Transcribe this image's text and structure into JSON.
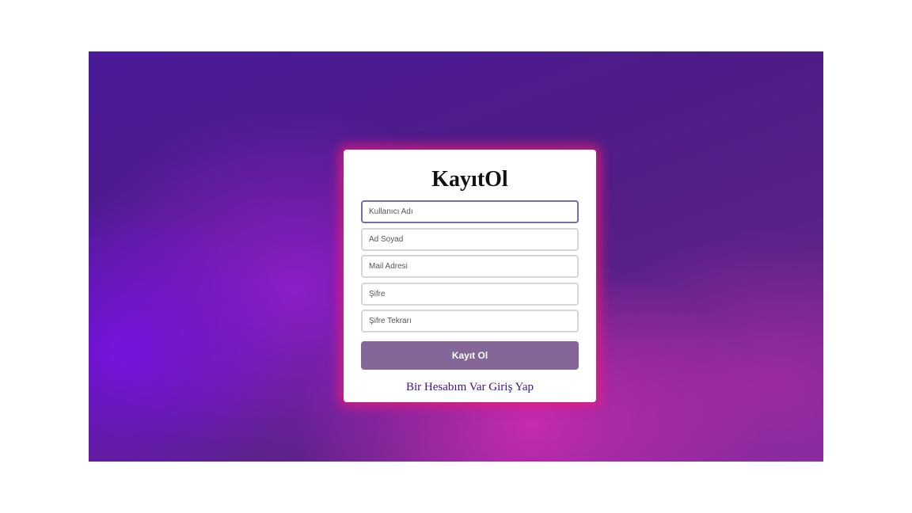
{
  "form": {
    "title": "KayıtOl",
    "fields": [
      {
        "placeholder": "Kullanıcı Adı",
        "value": ""
      },
      {
        "placeholder": "Ad Soyad",
        "value": ""
      },
      {
        "placeholder": "Mail Adresi",
        "value": ""
      },
      {
        "placeholder": "Şifre",
        "value": ""
      },
      {
        "placeholder": "Şifre Tekrarı",
        "value": ""
      }
    ],
    "submit_label": "Kayıt Ol",
    "login_link_label": "Bir Hesabım Var Giriş Yap"
  },
  "colors": {
    "background_primary": "#4f1c86",
    "background_accent": "#d62cb6",
    "card_glow": "#e81c78",
    "button": "#846698",
    "link": "#3a148a",
    "focused_border": "#7a6aa8"
  }
}
